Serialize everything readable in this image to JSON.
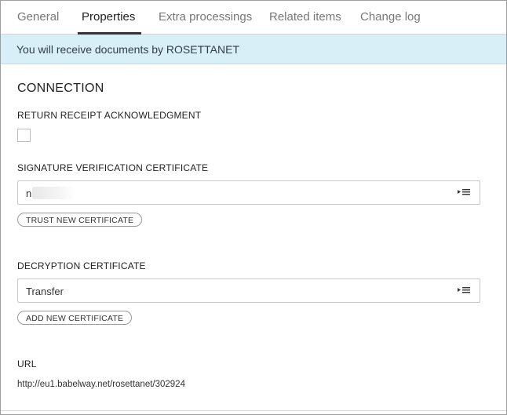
{
  "tabs": [
    {
      "label": "General"
    },
    {
      "label": "Properties"
    },
    {
      "label": "Extra processings"
    },
    {
      "label": "Related items"
    },
    {
      "label": "Change log"
    }
  ],
  "active_tab": "Properties",
  "banner": {
    "text": "You will receive documents by ROSETTANET"
  },
  "connection": {
    "title": "CONNECTION",
    "return_receipt": {
      "label": "RETURN RECEIPT ACKNOWLEDGMENT",
      "checked": false
    },
    "signature_cert": {
      "label": "SIGNATURE VERIFICATION CERTIFICATE",
      "value": "n",
      "button": "TRUST NEW CERTIFICATE",
      "icon": "list-select-icon"
    },
    "decryption_cert": {
      "label": "DECRYPTION CERTIFICATE",
      "value": "Transfer",
      "button": "ADD NEW CERTIFICATE",
      "icon": "list-select-icon"
    },
    "url": {
      "label": "URL",
      "value": "http://eu1.babelway.net/rosettanet/302924"
    }
  }
}
